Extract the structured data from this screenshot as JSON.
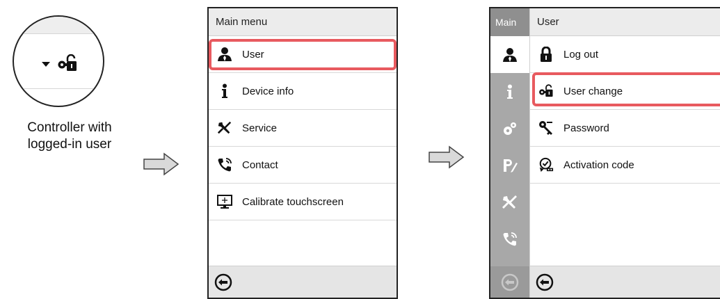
{
  "caption": {
    "line1": "Controller with",
    "line2": "logged-in user"
  },
  "main_menu": {
    "title": "Main menu",
    "items": [
      {
        "label": "User",
        "icon": "user-icon"
      },
      {
        "label": "Device info",
        "icon": "info-icon"
      },
      {
        "label": "Service",
        "icon": "tools-icon"
      },
      {
        "label": "Contact",
        "icon": "phone-icon"
      },
      {
        "label": "Calibrate touchscreen",
        "icon": "touchscreen-icon"
      }
    ],
    "highlighted": "User"
  },
  "user_menu": {
    "sidebar_title": "Main",
    "title": "User",
    "items": [
      {
        "label": "Log out",
        "icon": "lock-icon"
      },
      {
        "label": "User change",
        "icon": "user-key-icon"
      },
      {
        "label": "Password",
        "icon": "key-icon"
      },
      {
        "label": "Activation code",
        "icon": "activation-icon"
      }
    ],
    "highlighted": "User change"
  },
  "colors": {
    "highlight": "#e85a5f",
    "sidebar": "#a8a8a8",
    "header": "#ececec"
  }
}
